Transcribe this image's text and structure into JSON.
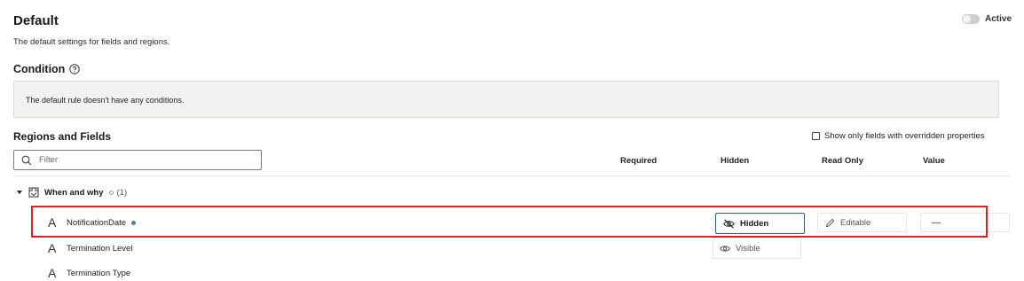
{
  "header": {
    "title": "Default",
    "subtitle": "The default settings for fields and regions.",
    "active_label": "Active"
  },
  "condition": {
    "title": "Condition",
    "message": "The default rule doesn't have any conditions."
  },
  "regions": {
    "title": "Regions and Fields",
    "override_label": "Show only fields with overridden properties",
    "filter_placeholder": "Filter",
    "columns": {
      "required": "Required",
      "hidden": "Hidden",
      "read_only": "Read Only",
      "value": "Value"
    },
    "group": {
      "name": "When and why",
      "count": "(1)"
    },
    "fields": [
      {
        "name": "NotificationDate",
        "hidden": "Hidden",
        "read_only": "Editable",
        "value": "—"
      },
      {
        "name": "Termination Level"
      },
      {
        "name": "Termination Type"
      }
    ],
    "dropdown_option": "Visible"
  },
  "colors": {
    "highlight": "#d9232b",
    "focus_border": "#3a5a78",
    "override_dot": "#5d7a88"
  }
}
